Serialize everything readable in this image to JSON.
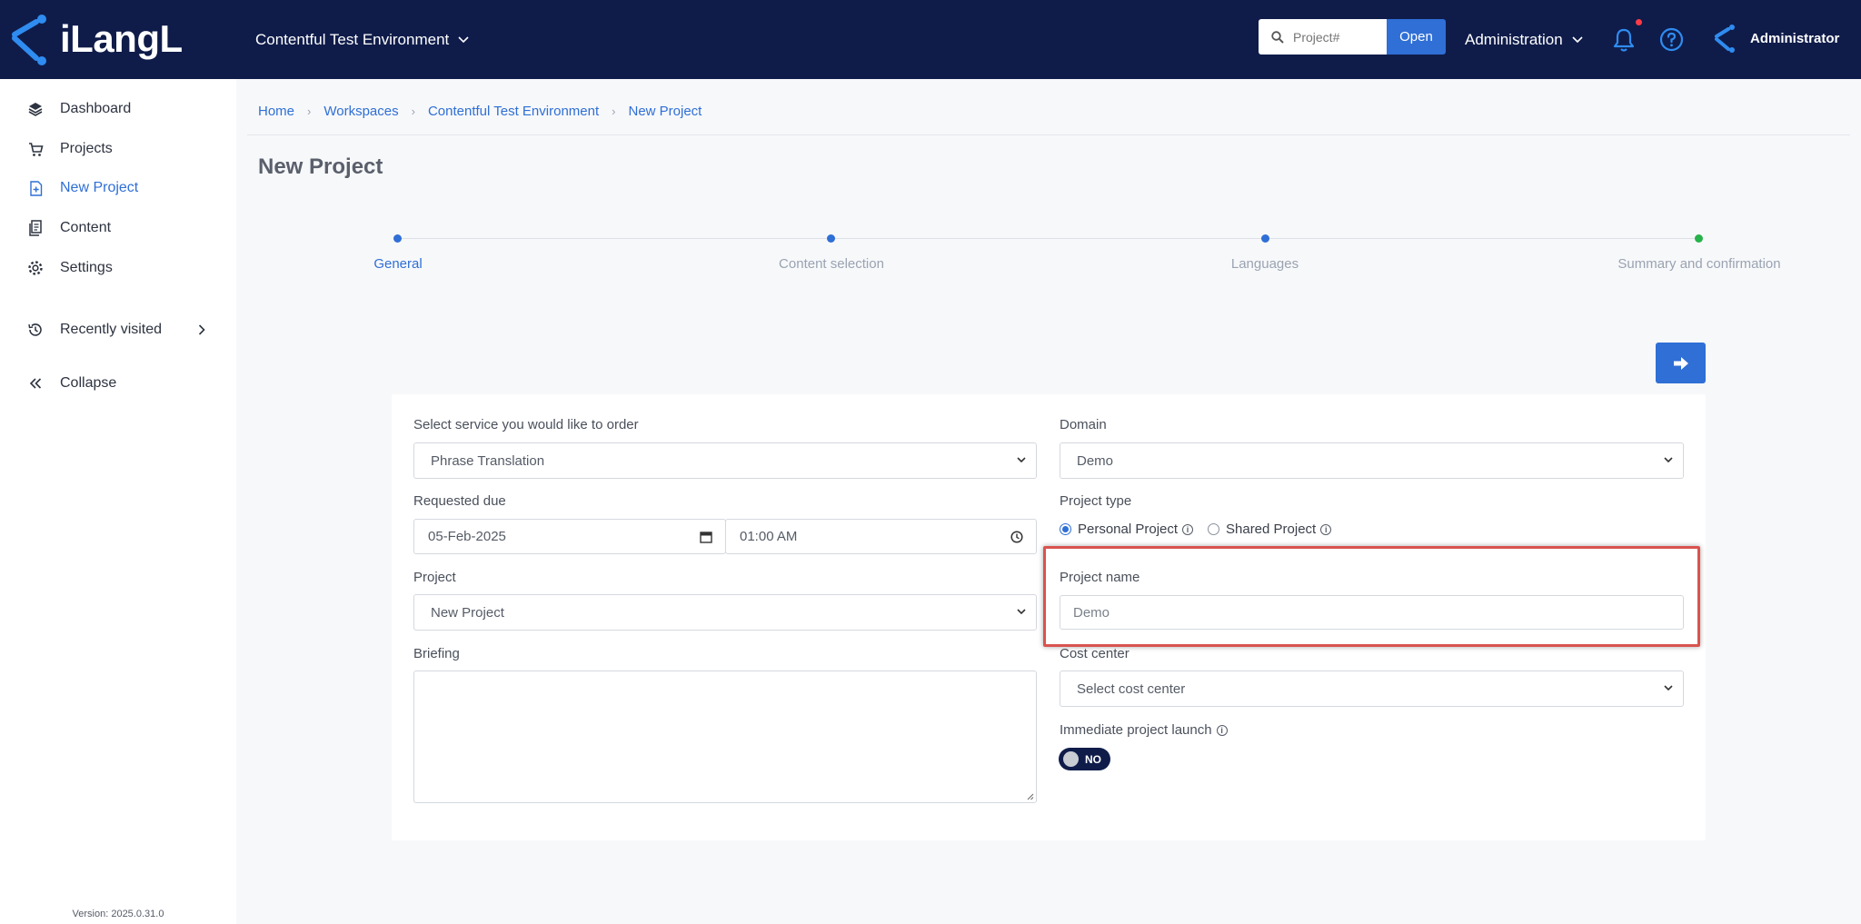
{
  "header": {
    "logo_text": "iLangL",
    "workspace": "Contentful Test Environment",
    "search_placeholder": "Project#",
    "open_label": "Open",
    "admin_menu": "Administration",
    "user_name": "Administrator"
  },
  "sidebar": {
    "items": [
      {
        "label": "Dashboard",
        "icon": "layers-icon"
      },
      {
        "label": "Projects",
        "icon": "cart-icon"
      },
      {
        "label": "New Project",
        "icon": "new-file-icon",
        "active": true
      },
      {
        "label": "Content",
        "icon": "documents-icon"
      },
      {
        "label": "Settings",
        "icon": "gear-icon"
      },
      {
        "label": "Recently visited",
        "icon": "history-icon"
      },
      {
        "label": "Collapse",
        "icon": "double-chevron-left-icon"
      }
    ],
    "version": "Version: 2025.0.31.0"
  },
  "breadcrumb": [
    "Home",
    "Workspaces",
    "Contentful Test Environment",
    "New Project"
  ],
  "page_title": "New Project",
  "stepper": {
    "steps": [
      "General",
      "Content selection",
      "Languages",
      "Summary and confirmation"
    ],
    "current": 0
  },
  "form": {
    "service_label": "Select service you would like to order",
    "service_value": "Phrase Translation",
    "domain_label": "Domain",
    "domain_value": "Demo",
    "due_label": "Requested due",
    "due_date": "05-Feb-2025",
    "due_time": "01:00 AM",
    "project_type_label": "Project type",
    "project_type_options": [
      "Personal Project",
      "Shared Project"
    ],
    "project_label": "Project",
    "project_value": "New Project",
    "project_name_label": "Project name",
    "project_name_placeholder": "Demo",
    "briefing_label": "Briefing",
    "cost_center_label": "Cost center",
    "cost_center_value": "Select cost center",
    "immediate_launch_label": "Immediate project launch",
    "immediate_launch_value": "NO"
  },
  "colors": {
    "header_bg": "#0f1c4a",
    "accent": "#2f6fd6",
    "highlight": "#d9534f",
    "summary_dot": "#27b24a"
  }
}
